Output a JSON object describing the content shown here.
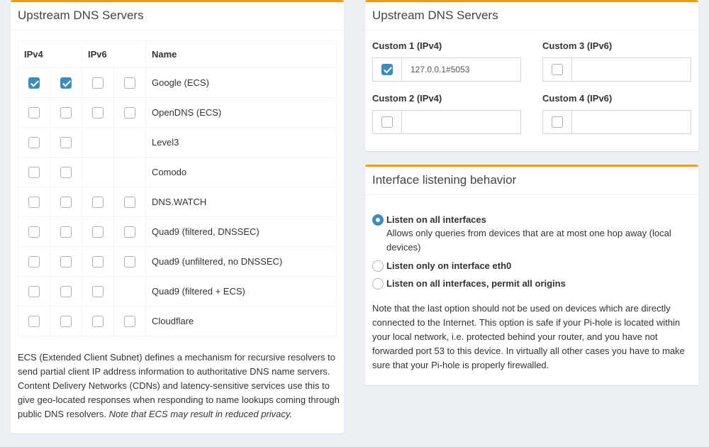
{
  "upstream": {
    "title": "Upstream DNS Servers",
    "columns": {
      "ipv4": "IPv4",
      "ipv6": "IPv6",
      "name": "Name"
    },
    "servers": [
      {
        "name": "Google (ECS)",
        "checks": [
          true,
          true,
          false,
          false
        ],
        "has_ipv6": true
      },
      {
        "name": "OpenDNS (ECS)",
        "checks": [
          false,
          false,
          false,
          false
        ],
        "has_ipv6": true
      },
      {
        "name": "Level3",
        "checks": [
          false,
          false
        ],
        "has_ipv6": false
      },
      {
        "name": "Comodo",
        "checks": [
          false,
          false
        ],
        "has_ipv6": false
      },
      {
        "name": "DNS.WATCH",
        "checks": [
          false,
          false,
          false,
          false
        ],
        "has_ipv6": true
      },
      {
        "name": "Quad9 (filtered, DNSSEC)",
        "checks": [
          false,
          false,
          false,
          false
        ],
        "has_ipv6": true
      },
      {
        "name": "Quad9 (unfiltered, no DNSSEC)",
        "checks": [
          false,
          false,
          false,
          false
        ],
        "has_ipv6": true
      },
      {
        "name": "Quad9 (filtered + ECS)",
        "checks": [
          false,
          false,
          false
        ],
        "has_ipv6": true
      },
      {
        "name": "Cloudflare",
        "checks": [
          false,
          false,
          false,
          false
        ],
        "has_ipv6": true
      }
    ],
    "ecs_note": "ECS (Extended Client Subnet) defines a mechanism for recursive resolvers to send partial client IP address information to authoritative DNS name servers. Content Delivery Networks (CDNs) and latency-sensitive services use this to give geo-located responses when responding to name lookups coming through public DNS resolvers. ",
    "ecs_note_em": "Note that ECS may result in reduced privacy."
  },
  "custom": {
    "title": "Upstream DNS Servers",
    "fields": [
      {
        "label": "Custom 1 (IPv4)",
        "value": "127.0.0.1#5053",
        "checked": true
      },
      {
        "label": "Custom 3 (IPv6)",
        "value": "",
        "checked": false
      },
      {
        "label": "Custom 2 (IPv4)",
        "value": "",
        "checked": false
      },
      {
        "label": "Custom 4 (IPv6)",
        "value": "",
        "checked": false
      }
    ]
  },
  "interface": {
    "title": "Interface listening behavior",
    "options": [
      {
        "label": "Listen on all interfaces",
        "selected": true
      },
      {
        "label": "Listen only on interface eth0",
        "selected": false
      },
      {
        "label": "Listen on all interfaces, permit all origins",
        "selected": false
      }
    ],
    "option1_help": "Allows only queries from devices that are at most one hop away (local devices)",
    "note": "Note that the last option should not be used on devices which are directly connected to the Internet. This option is safe if your Pi-hole is located within your local network, i.e. protected behind your router, and you have not forwarded port 53 to this device. In virtually all other cases you have to make sure that your Pi-hole is properly firewalled."
  },
  "colors": {
    "accent": "#f39c12",
    "checkbox_checked": "#3c8dbc",
    "background": "#ecf0f5"
  }
}
